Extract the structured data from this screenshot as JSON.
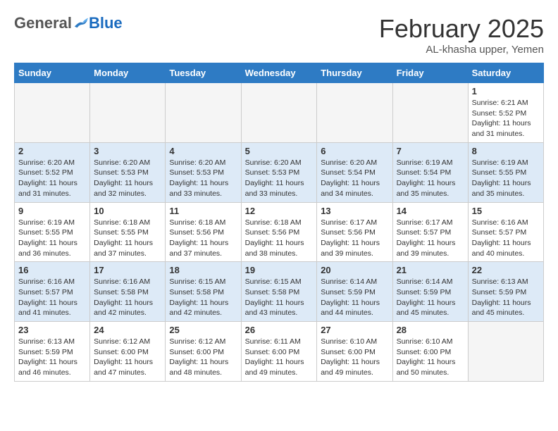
{
  "header": {
    "logo_general": "General",
    "logo_blue": "Blue",
    "month_title": "February 2025",
    "subtitle": "AL-khasha upper, Yemen"
  },
  "days_of_week": [
    "Sunday",
    "Monday",
    "Tuesday",
    "Wednesday",
    "Thursday",
    "Friday",
    "Saturday"
  ],
  "weeks": [
    [
      {
        "day": "",
        "info": ""
      },
      {
        "day": "",
        "info": ""
      },
      {
        "day": "",
        "info": ""
      },
      {
        "day": "",
        "info": ""
      },
      {
        "day": "",
        "info": ""
      },
      {
        "day": "",
        "info": ""
      },
      {
        "day": "1",
        "info": "Sunrise: 6:21 AM\nSunset: 5:52 PM\nDaylight: 11 hours and 31 minutes."
      }
    ],
    [
      {
        "day": "2",
        "info": "Sunrise: 6:20 AM\nSunset: 5:52 PM\nDaylight: 11 hours and 31 minutes."
      },
      {
        "day": "3",
        "info": "Sunrise: 6:20 AM\nSunset: 5:53 PM\nDaylight: 11 hours and 32 minutes."
      },
      {
        "day": "4",
        "info": "Sunrise: 6:20 AM\nSunset: 5:53 PM\nDaylight: 11 hours and 33 minutes."
      },
      {
        "day": "5",
        "info": "Sunrise: 6:20 AM\nSunset: 5:53 PM\nDaylight: 11 hours and 33 minutes."
      },
      {
        "day": "6",
        "info": "Sunrise: 6:20 AM\nSunset: 5:54 PM\nDaylight: 11 hours and 34 minutes."
      },
      {
        "day": "7",
        "info": "Sunrise: 6:19 AM\nSunset: 5:54 PM\nDaylight: 11 hours and 35 minutes."
      },
      {
        "day": "8",
        "info": "Sunrise: 6:19 AM\nSunset: 5:55 PM\nDaylight: 11 hours and 35 minutes."
      }
    ],
    [
      {
        "day": "9",
        "info": "Sunrise: 6:19 AM\nSunset: 5:55 PM\nDaylight: 11 hours and 36 minutes."
      },
      {
        "day": "10",
        "info": "Sunrise: 6:18 AM\nSunset: 5:55 PM\nDaylight: 11 hours and 37 minutes."
      },
      {
        "day": "11",
        "info": "Sunrise: 6:18 AM\nSunset: 5:56 PM\nDaylight: 11 hours and 37 minutes."
      },
      {
        "day": "12",
        "info": "Sunrise: 6:18 AM\nSunset: 5:56 PM\nDaylight: 11 hours and 38 minutes."
      },
      {
        "day": "13",
        "info": "Sunrise: 6:17 AM\nSunset: 5:56 PM\nDaylight: 11 hours and 39 minutes."
      },
      {
        "day": "14",
        "info": "Sunrise: 6:17 AM\nSunset: 5:57 PM\nDaylight: 11 hours and 39 minutes."
      },
      {
        "day": "15",
        "info": "Sunrise: 6:16 AM\nSunset: 5:57 PM\nDaylight: 11 hours and 40 minutes."
      }
    ],
    [
      {
        "day": "16",
        "info": "Sunrise: 6:16 AM\nSunset: 5:57 PM\nDaylight: 11 hours and 41 minutes."
      },
      {
        "day": "17",
        "info": "Sunrise: 6:16 AM\nSunset: 5:58 PM\nDaylight: 11 hours and 42 minutes."
      },
      {
        "day": "18",
        "info": "Sunrise: 6:15 AM\nSunset: 5:58 PM\nDaylight: 11 hours and 42 minutes."
      },
      {
        "day": "19",
        "info": "Sunrise: 6:15 AM\nSunset: 5:58 PM\nDaylight: 11 hours and 43 minutes."
      },
      {
        "day": "20",
        "info": "Sunrise: 6:14 AM\nSunset: 5:59 PM\nDaylight: 11 hours and 44 minutes."
      },
      {
        "day": "21",
        "info": "Sunrise: 6:14 AM\nSunset: 5:59 PM\nDaylight: 11 hours and 45 minutes."
      },
      {
        "day": "22",
        "info": "Sunrise: 6:13 AM\nSunset: 5:59 PM\nDaylight: 11 hours and 45 minutes."
      }
    ],
    [
      {
        "day": "23",
        "info": "Sunrise: 6:13 AM\nSunset: 5:59 PM\nDaylight: 11 hours and 46 minutes."
      },
      {
        "day": "24",
        "info": "Sunrise: 6:12 AM\nSunset: 6:00 PM\nDaylight: 11 hours and 47 minutes."
      },
      {
        "day": "25",
        "info": "Sunrise: 6:12 AM\nSunset: 6:00 PM\nDaylight: 11 hours and 48 minutes."
      },
      {
        "day": "26",
        "info": "Sunrise: 6:11 AM\nSunset: 6:00 PM\nDaylight: 11 hours and 49 minutes."
      },
      {
        "day": "27",
        "info": "Sunrise: 6:10 AM\nSunset: 6:00 PM\nDaylight: 11 hours and 49 minutes."
      },
      {
        "day": "28",
        "info": "Sunrise: 6:10 AM\nSunset: 6:00 PM\nDaylight: 11 hours and 50 minutes."
      },
      {
        "day": "",
        "info": ""
      }
    ]
  ]
}
